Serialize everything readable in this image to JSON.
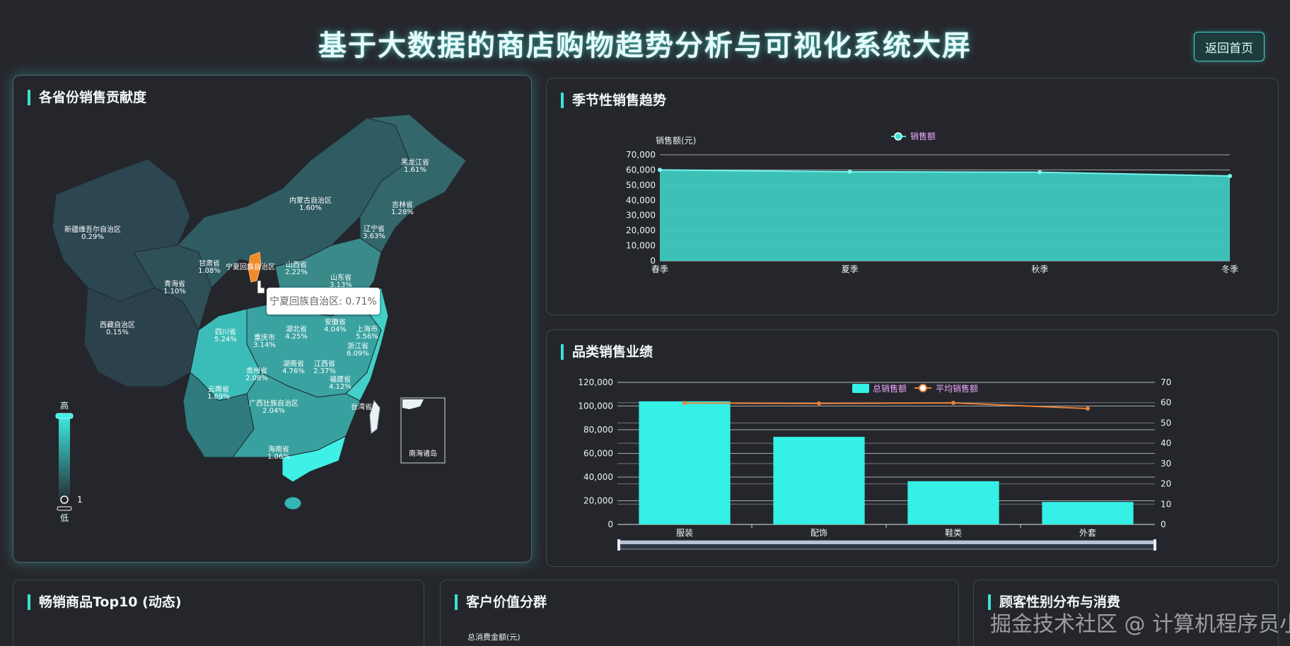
{
  "header": {
    "title": "基于大数据的商店购物趋势分析与可视化系统大屏",
    "home_button": "返回首页"
  },
  "panels": {
    "province": "各省份销售贡献度",
    "season": "季节性销售趋势",
    "category": "品类销售业绩",
    "top10": "畅销商品Top10 (动态)",
    "customer": "客户价值分群",
    "gender": "顾客性别分布与消费"
  },
  "map": {
    "tooltip": "宁夏回族自治区: 0.71%",
    "legend_high": "高",
    "legend_low": "低",
    "legend_value": "1",
    "south_sea_label": "南海诸岛",
    "highlight_color": "#f08a2a",
    "labels": [
      {
        "name": "黑龙江省",
        "value": "1.61%"
      },
      {
        "name": "内蒙古自治区",
        "value": "1.60%"
      },
      {
        "name": "吉林省",
        "value": "1.28%"
      },
      {
        "name": "新疆维吾尔自治区",
        "value": "0.29%"
      },
      {
        "name": "辽宁省",
        "value": "3.63%"
      },
      {
        "name": "甘肃省",
        "value": "1.08%"
      },
      {
        "name": "宁夏回族自治区",
        "value": ""
      },
      {
        "name": "山西省",
        "value": "2.22%"
      },
      {
        "name": "青海省",
        "value": "1.10%"
      },
      {
        "name": "山东省",
        "value": "3.13%"
      },
      {
        "name": "西藏自治区",
        "value": "0.15%"
      },
      {
        "name": "四川省",
        "value": "5.24%"
      },
      {
        "name": "重庆市",
        "value": "3.14%"
      },
      {
        "name": "湖北省",
        "value": "4.25%"
      },
      {
        "name": "安徽省",
        "value": "4.04%"
      },
      {
        "name": "上海市",
        "value": "5.56%"
      },
      {
        "name": "浙江省",
        "value": "6.09%"
      },
      {
        "name": "湖南省",
        "value": "4.76%"
      },
      {
        "name": "江西省",
        "value": "2.37%"
      },
      {
        "name": "贵州省",
        "value": "2.08%"
      },
      {
        "name": "福建省",
        "value": "4.12%"
      },
      {
        "name": "云南省",
        "value": "1.69%"
      },
      {
        "name": "广西壮族自治区",
        "value": "2.04%"
      },
      {
        "name": "台湾省",
        "value": ""
      },
      {
        "name": "海南省",
        "value": "1.06%"
      }
    ]
  },
  "season_chart": {
    "type": "area",
    "ylabel": "销售额(元)",
    "legend": "销售额",
    "categories": [
      "春季",
      "夏季",
      "秋季",
      "冬季"
    ],
    "values": [
      60000,
      58800,
      58500,
      56000
    ],
    "yticks": [
      "0",
      "10,000",
      "20,000",
      "30,000",
      "40,000",
      "50,000",
      "60,000",
      "70,000"
    ],
    "ylim": [
      0,
      70000
    ],
    "color": "#3ee0d4"
  },
  "category_chart": {
    "type": "bar",
    "categories": [
      "服装",
      "配饰",
      "鞋类",
      "外套"
    ],
    "series": [
      {
        "name": "总销售额",
        "type": "bar",
        "values": [
          104000,
          74000,
          36500,
          19000
        ],
        "axis": "left"
      },
      {
        "name": "平均销售额",
        "type": "line",
        "values": [
          59.8,
          59.6,
          59.9,
          57.1
        ],
        "axis": "right"
      }
    ],
    "yticks_left": [
      "0",
      "20,000",
      "40,000",
      "60,000",
      "80,000",
      "100,000",
      "120,000"
    ],
    "ylim_left": [
      0,
      120000
    ],
    "yticks_right": [
      "0",
      "10",
      "20",
      "30",
      "40",
      "50",
      "60",
      "70"
    ],
    "ylim_right": [
      0,
      70
    ],
    "bar_color": "#34f0e6",
    "line_color": "#e8823a"
  },
  "customer_chart": {
    "ylabel": "总消费金额(元)"
  },
  "watermark": "掘金技术社区 @ 计算机程序员小杨"
}
